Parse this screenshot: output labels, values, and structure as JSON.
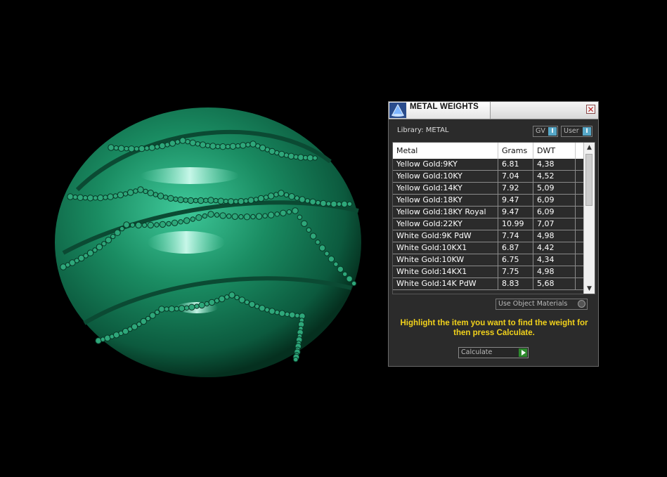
{
  "dialog": {
    "title": "METAL WEIGHTS",
    "close_glyph": "✕",
    "library_label": "Library: METAL",
    "toggles": [
      {
        "label": "GV",
        "knob": "I"
      },
      {
        "label": "User",
        "knob": "I"
      }
    ],
    "table": {
      "columns": [
        "Metal",
        "Grams",
        "DWT"
      ],
      "rows": [
        [
          "Yellow Gold:9KY",
          "6.81",
          "4,38"
        ],
        [
          "Yellow Gold:10KY",
          "7.04",
          "4,52"
        ],
        [
          "Yellow Gold:14KY",
          "7.92",
          "5,09"
        ],
        [
          "Yellow Gold:18KY",
          "9.47",
          "6,09"
        ],
        [
          "Yellow Gold:18KY Royal",
          "9.47",
          "6,09"
        ],
        [
          "Yellow Gold:22KY",
          "10.99",
          "7,07"
        ],
        [
          "White Gold:9K PdW",
          "7.74",
          "4,98"
        ],
        [
          "White Gold:10KX1",
          "6.87",
          "4,42"
        ],
        [
          "White Gold:10KW",
          "6.75",
          "4,34"
        ],
        [
          "White Gold:14KX1",
          "7.75",
          "4,98"
        ],
        [
          "White Gold:14K PdW",
          "8.83",
          "5,68"
        ]
      ],
      "scroll_up_glyph": "▲",
      "scroll_down_glyph": "▼"
    },
    "use_object_materials_label": "Use Object Materials",
    "instruction": "Highlight the item you want to find the weight for then press Calculate.",
    "calculate_label": "Calculate"
  },
  "viewport": {
    "object_description": "green jewelry sphere with beaded bands",
    "object_color": "#1e8a62"
  }
}
